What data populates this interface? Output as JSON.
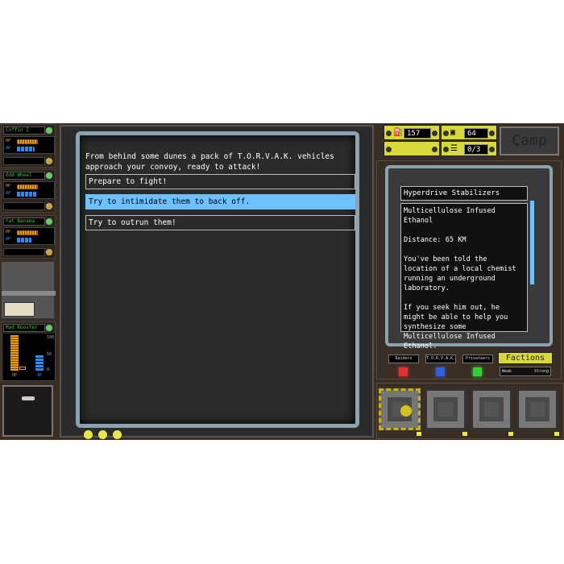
{
  "vehicles": [
    {
      "name": "Coffin I",
      "hp_label": "HP",
      "ap_label": "AP",
      "ap_fraction": 0.55
    },
    {
      "name": "Odd Wheel",
      "hp_label": "HP",
      "ap_label": "AP",
      "ap_fraction": 0.65
    },
    {
      "name": "Fat Banana",
      "hp_label": "HP",
      "ap_label": "AP",
      "ap_fraction": 0.45
    }
  ],
  "selected_vehicle": {
    "name": "Mad Rooster",
    "hp_label": "HP",
    "ap_label": "AP",
    "scale": [
      "100",
      "50",
      "0"
    ],
    "hp_fraction": 1.0,
    "ap_fraction": 0.4
  },
  "event": {
    "text": "From behind some dunes a pack of T.O.R.V.A.K. vehicles approach your convoy, ready to attack!",
    "options": [
      "Prepare to fight!",
      "Try to intimidate them to back off.",
      "Try to outrun them!"
    ],
    "selected_option": 1
  },
  "resources": {
    "fuel": "157",
    "food": "64",
    "crew": "0/3"
  },
  "camp_label": "Camp",
  "info": {
    "title": "Hyperdrive Stabilizers",
    "body": [
      "Multicellulose Infused Ethanol",
      "Distance: 65 KM",
      "You've been told the location of a local chemist running an underground laboratory.",
      "If you seek him out, he might be able to help you synthesize some Multicellulose Infused Ethanol."
    ]
  },
  "factions": {
    "label": "Factions",
    "list": [
      {
        "name": "Raiders",
        "color": "#e53030"
      },
      {
        "name": "T.O.R.V.A.K.",
        "color": "#3060e0"
      },
      {
        "name": "Privateers",
        "color": "#30d030"
      }
    ],
    "weak_label": "Weak",
    "strong_label": "Strong"
  }
}
